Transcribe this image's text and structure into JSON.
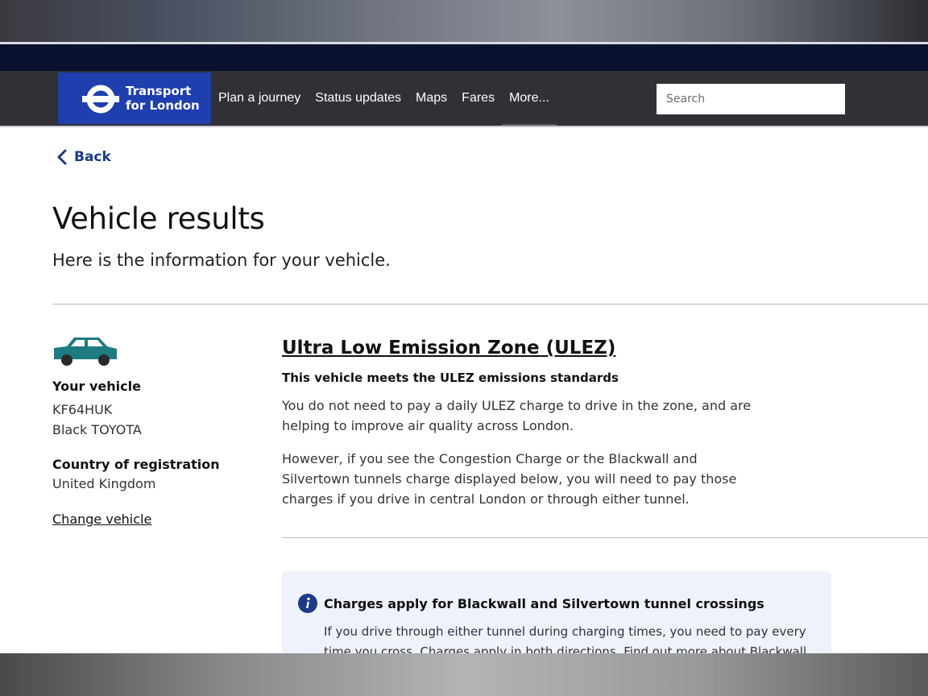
{
  "header": {
    "logo_line1": "Transport",
    "logo_line2": "for London",
    "nav": [
      "Plan a journey",
      "Status updates",
      "Maps",
      "Fares",
      "More..."
    ],
    "search_placeholder": "Search"
  },
  "back_label": "Back",
  "page": {
    "title": "Vehicle results",
    "subtitle": "Here is the information for your vehicle."
  },
  "vehicle": {
    "label": "Your vehicle",
    "registration": "KF64HUK",
    "description": "Black TOYOTA",
    "country_label": "Country of registration",
    "country": "United Kingdom",
    "change_link": "Change vehicle",
    "car_color": "#1e7b80"
  },
  "ulez": {
    "title": "Ultra Low Emission Zone (ULEZ)",
    "status": "This vehicle meets the ULEZ emissions standards",
    "para1": "You do not need to pay a daily ULEZ charge to drive in the zone, and are helping to improve air quality across London.",
    "para2": "However, if you see the Congestion Charge or the Blackwall and Silvertown tunnels charge displayed below, you will need to pay those charges if you drive in central London or through either tunnel."
  },
  "info": {
    "icon": "info-icon",
    "title": "Charges apply for Blackwall and Silvertown tunnel crossings",
    "text": "If you drive through either tunnel during charging times, you need to pay every time you cross. Charges apply in both directions. Find out more about Blackwall"
  },
  "colors": {
    "brand_blue": "#1f3fae",
    "header_bg": "#2f3136",
    "link_blue": "#1d3a8a",
    "info_bg": "#eef2fb"
  }
}
